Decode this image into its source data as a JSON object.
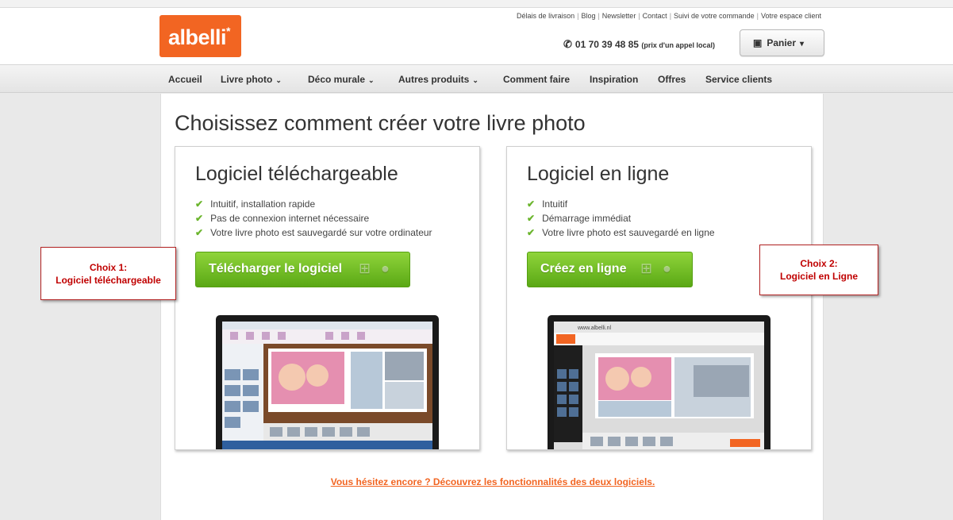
{
  "brand": {
    "logo_text": "albelli",
    "logo_star": "*",
    "accent": "#f26522",
    "green": "#6bb52d"
  },
  "toplinks": [
    "Délais de livraison",
    "Blog",
    "Newsletter",
    "Contact",
    "Suivi de votre commande",
    "Votre espace client"
  ],
  "phone": {
    "icon": "phone-icon",
    "number": "01 70 39 48 85",
    "note": "(prix d'un appel local)"
  },
  "cart": {
    "icon": "basket-icon",
    "label": "Panier"
  },
  "nav": [
    "Accueil",
    "Livre photo",
    "Déco murale",
    "Autres produits",
    "Comment faire",
    "Inspiration",
    "Offres",
    "Service clients"
  ],
  "main": {
    "title": "Choisissez comment créer votre livre photo",
    "promo_link": "Vous hésitez encore ? Découvrez les fonctionnalités des deux logiciels."
  },
  "cards": [
    {
      "heading": "Logiciel téléchargeable",
      "features": [
        "Intuitif, installation rapide",
        "Pas de connexion internet nécessaire",
        "Votre livre photo est sauvegardé sur votre ordinateur"
      ],
      "button": "Télécharger le logiciel"
    },
    {
      "heading": "Logiciel en ligne",
      "features": [
        "Intuitif",
        "Démarrage immédiat",
        "Votre livre photo est sauvegardé en ligne"
      ],
      "button": "Créez en ligne",
      "browser_url": "www.albelli.nl"
    }
  ],
  "callouts": [
    {
      "line1": "Choix 1:",
      "line2": "Logiciel téléchargeable"
    },
    {
      "line1": "Choix 2:",
      "line2": "Logiciel en Ligne"
    }
  ]
}
